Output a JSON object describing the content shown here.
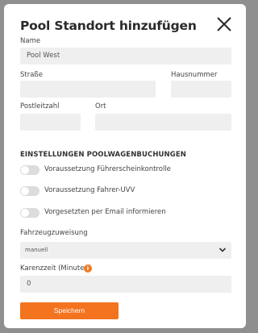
{
  "dialog": {
    "title": "Pool Standort hinzufügen",
    "close_icon": "close-icon"
  },
  "form": {
    "name": {
      "label": "Name",
      "value": "Pool West"
    },
    "street": {
      "label": "Straße",
      "value": ""
    },
    "house_number": {
      "label": "Hausnummer",
      "value": ""
    },
    "postal_code": {
      "label": "Postleitzahl",
      "value": ""
    },
    "city": {
      "label": "Ort",
      "value": ""
    }
  },
  "settings": {
    "section_title": "EINSTELLUNGEN POOLWAGENBUCHUNGEN",
    "toggles": [
      {
        "label": "Voraussetzung Führerscheinkontrolle",
        "on": false
      },
      {
        "label": "Voraussetzung Fahrer-UVV",
        "on": false
      },
      {
        "label": "Vorgesetzten per Email informieren",
        "on": false
      }
    ]
  },
  "vehicle_assignment": {
    "label": "Fahrzeugzuweisung",
    "selected": "manuell"
  },
  "grace_period": {
    "label": "Karenzzeit (Minuten)",
    "info_icon": "info-icon",
    "value": "0"
  },
  "save_button": {
    "label": "Speichern"
  },
  "colors": {
    "accent": "#f4731f",
    "field_bg": "#efefef",
    "overlay": "#8f8f8f"
  }
}
